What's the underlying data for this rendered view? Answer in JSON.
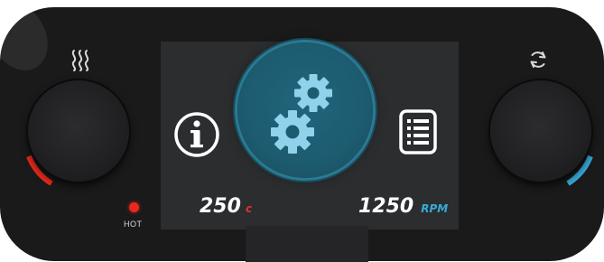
{
  "panel": {
    "hot_label": "HOT"
  },
  "display": {
    "temperature": {
      "value": "250",
      "unit": "c"
    },
    "speed": {
      "value": "1250",
      "unit": "RPM"
    }
  },
  "icons": {
    "heat": "heat-waves-icon",
    "speed": "rotate-cycle-icon",
    "info": "info-icon",
    "settings": "gears-icon",
    "menu": "list-menu-icon"
  },
  "colors": {
    "panel": "#1a1a1b",
    "screen": "#2b2d2f",
    "hot": "#e8291c",
    "cool": "#3aa9d8",
    "settings_button": "#1d5b70",
    "gear": "#8fd2ea"
  }
}
